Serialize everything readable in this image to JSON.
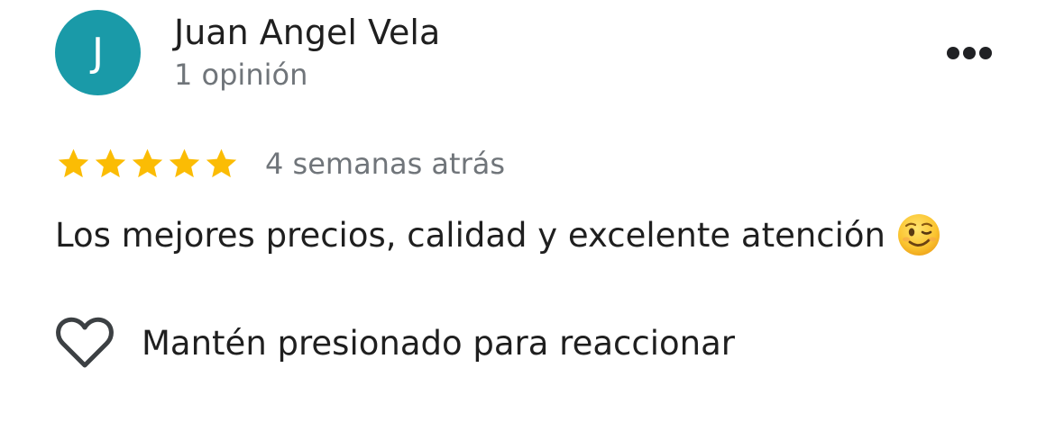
{
  "author": {
    "initial": "J",
    "name": "Juan Angel Vela",
    "meta": "1 opinión",
    "avatar_color": "#1a9aa8"
  },
  "menu": {
    "icon": "more-horizontal-icon"
  },
  "rating": {
    "stars": 5,
    "max_stars": 5,
    "star_color": "#fbbc04",
    "date": "4 semanas atrás"
  },
  "review": {
    "text": "Los mejores precios, calidad y excelente atención",
    "emoji": "winking-face-emoji"
  },
  "reaction": {
    "icon": "heart-outline-icon",
    "label": "Mantén presionado para reaccionar"
  }
}
